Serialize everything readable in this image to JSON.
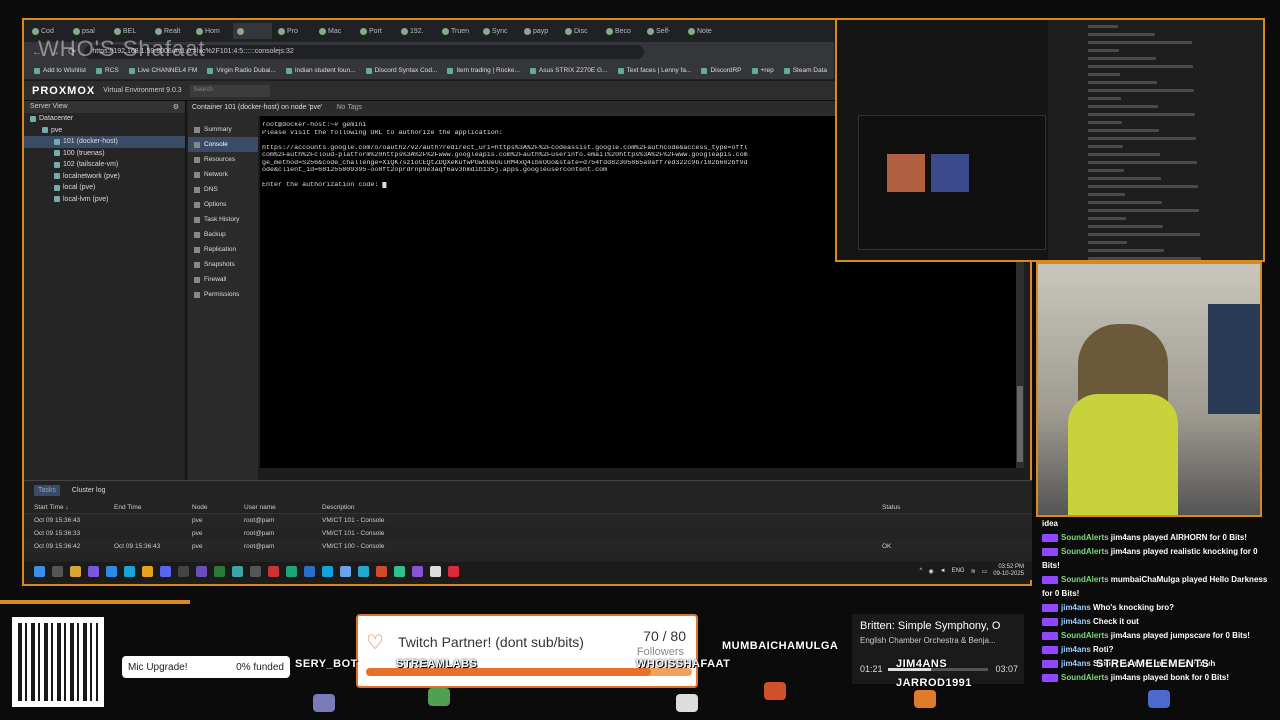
{
  "watermark": "WHO'S Shafaat",
  "browser": {
    "tabs": [
      "Cod",
      "psal",
      "BEL",
      "Realt",
      "Hom",
      "",
      "Pro",
      "Mac",
      "Port",
      "192.",
      "Truen",
      "Sync",
      "payp",
      "Disc",
      "Beco",
      "Self-",
      "Note"
    ],
    "url": "https://192.168.1.59:8006/#v1:0:=lxc%2F101:4:5::::::consolejs:32",
    "bookmarks": [
      "Add to Wishlist",
      "RCS",
      "Live CHANNEL4 FM",
      "Virgin Radio Dubai...",
      "Indian student foun...",
      "Discord Syntax Cod...",
      "Item trading | Rocke...",
      "Asus STRIX Z270E G...",
      "Text faces | Lenny fa...",
      "DiscordRP",
      "+rep",
      "Steam Data"
    ]
  },
  "pve": {
    "logo": "PROXMOX",
    "version": "Virtual Environment 9.0.3",
    "search_placeholder": "Search",
    "server_view": "Server View",
    "tree": [
      {
        "label": "Datacenter",
        "indent": 0
      },
      {
        "label": "pve",
        "indent": 1
      },
      {
        "label": "101 (docker-host)",
        "indent": 2,
        "selected": true
      },
      {
        "label": "100 (truenas)",
        "indent": 2
      },
      {
        "label": "102 (tailscale-vm)",
        "indent": 2
      },
      {
        "label": "localnetwork (pve)",
        "indent": 2
      },
      {
        "label": "local (pve)",
        "indent": 2
      },
      {
        "label": "local-lvm (pve)",
        "indent": 2
      }
    ],
    "container_title": "Container 101 (docker-host) on node 'pve'",
    "no_tags": "No Tags",
    "menu": [
      "Summary",
      "Console",
      "Resources",
      "Network",
      "DNS",
      "Options",
      "Task History",
      "Backup",
      "Replication",
      "Snapshots",
      "Firewall",
      "Permissions"
    ]
  },
  "terminal": {
    "lines": [
      "root@docker-host:~# gemini",
      "Please visit the following URL to authorize the application:",
      "",
      "https://accounts.google.com/o/oauth2/v2/auth?redirect_uri=https%3A%2F%2Fcodeassist.google.com%2Fauthcode&access_type=offl",
      "com%2Fauth%2Fcloud-platform%20https%3A%2F%2Fwww.googleapis.com%2Fauth%2Fuserinfo.email%20https%3A%2F%2Fwww.googleapis.com",
      "ge_method=S256&code_challenge=XiQK7sz1oCEQtZDQXeKufwPGwOUeUulRM4xQ4IbkOGo&state=d754fdd82305865a9aff7ed322c9b7182b602bf9d",
      "ode&client_id=681255809395-oo8ft2oprdrnp9e3aqf6av3hmdib135j.apps.googleusercontent.com",
      "",
      "Enter the authorization code: "
    ]
  },
  "tasks": {
    "tabs": [
      "Tasks",
      "Cluster log"
    ],
    "columns": [
      "Start Time ↓",
      "End Time",
      "Node",
      "User name",
      "Description",
      "Status"
    ],
    "rows": [
      {
        "start": "Oct 09 15:36:43",
        "end": "",
        "node": "pve",
        "user": "root@pam",
        "desc": "VM/CT 101 - Console",
        "status": ""
      },
      {
        "start": "Oct 09 15:36:33",
        "end": "",
        "node": "pve",
        "user": "root@pam",
        "desc": "VM/CT 101 - Console",
        "status": ""
      },
      {
        "start": "Oct 09 15:36:42",
        "end": "Oct 09 15:36:43",
        "node": "pve",
        "user": "root@pam",
        "desc": "VM/CT 100 - Console",
        "status": "OK"
      }
    ]
  },
  "tray": {
    "lang": "ENG",
    "time": "03:52 PM",
    "date": "09-10-2025"
  },
  "chat": [
    {
      "user": "",
      "msg": "idea"
    },
    {
      "user": "SoundAlerts",
      "msg": "jim4ans played AIRHORN for 0 Bits!"
    },
    {
      "user": "SoundAlerts",
      "msg": "jim4ans played realistic knocking for 0 Bits!"
    },
    {
      "user": "SoundAlerts",
      "msg": "mumbaiChaMulga played Hello Darkness for 0 Bits!"
    },
    {
      "user": "jim4ans",
      "msg": "Who's knocking bro?"
    },
    {
      "user": "jim4ans",
      "msg": "Check it out"
    },
    {
      "user": "SoundAlerts",
      "msg": "jim4ans played jumpscare for 0 Bits!"
    },
    {
      "user": "jim4ans",
      "msg": "Roti?"
    },
    {
      "user": "jim4ans",
      "msg": "Stop, you make me hungry bruh"
    },
    {
      "user": "SoundAlerts",
      "msg": "jim4ans played bonk for 0 Bits!"
    }
  ],
  "overlay": {
    "mic_goal_label": "Mic Upgrade!",
    "mic_goal_value": "0% funded",
    "partner_title": "Twitch Partner! (dont sub/bits)",
    "partner_count": "70 / 80",
    "partner_followers": "Followers",
    "partner_progress": 0.875,
    "song_title": "Britten: Simple Symphony, O",
    "song_artist": "English Chamber Orchestra & Benja...",
    "song_elapsed": "01:21",
    "song_total": "03:07",
    "song_progress": 0.43,
    "nameplates": [
      "SERY_BOT",
      "STREAMLABS",
      "WHOISSHAFAAT",
      "MUMBAICHAMULGA",
      "JIM4ANS",
      "JARROD1991",
      "STREAMELEMENTS"
    ]
  },
  "colors": {
    "accent": "#d88a1c",
    "proxmox": "#e57000",
    "partner": "#e6722a"
  }
}
